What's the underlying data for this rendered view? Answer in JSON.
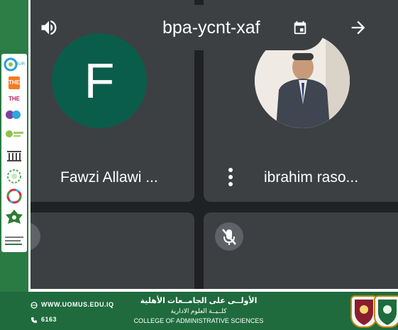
{
  "meeting": {
    "code": "bpa-ycnt-xaf"
  },
  "participants": [
    {
      "name": "Fawzi Allawi ...",
      "avatar_letter": "F",
      "avatar_color": "#0b5d4b"
    },
    {
      "name": "ibrahim raso...",
      "avatar_type": "photo"
    }
  ],
  "icons": {
    "speaker": "volume-icon",
    "calendar": "calendar-icon",
    "arrow": "arrow-right-icon",
    "more": "more-vert-icon",
    "mic_off": "mic-off-icon"
  },
  "logos": [
    "RUR",
    "THE",
    "THE",
    "EDUinformation",
    "UI GreenMetric",
    "Institution",
    "Sustainability",
    "SDG",
    "Arab Academic",
    "Webometrics"
  ],
  "footer": {
    "website": "WWW.UOMUS.EDU.IQ",
    "phone": "6163",
    "arabic_university": "الأولــى على الجامــعات الأهلية",
    "arabic_college": "كلــيــة العلوم الادارية",
    "college_en": "COLLEGE OF ADMINISTRATIVE SCIENCES"
  },
  "colors": {
    "frame_green": "#1f6b3e",
    "meet_bg": "#202124",
    "tile_bg": "#3c4043"
  }
}
